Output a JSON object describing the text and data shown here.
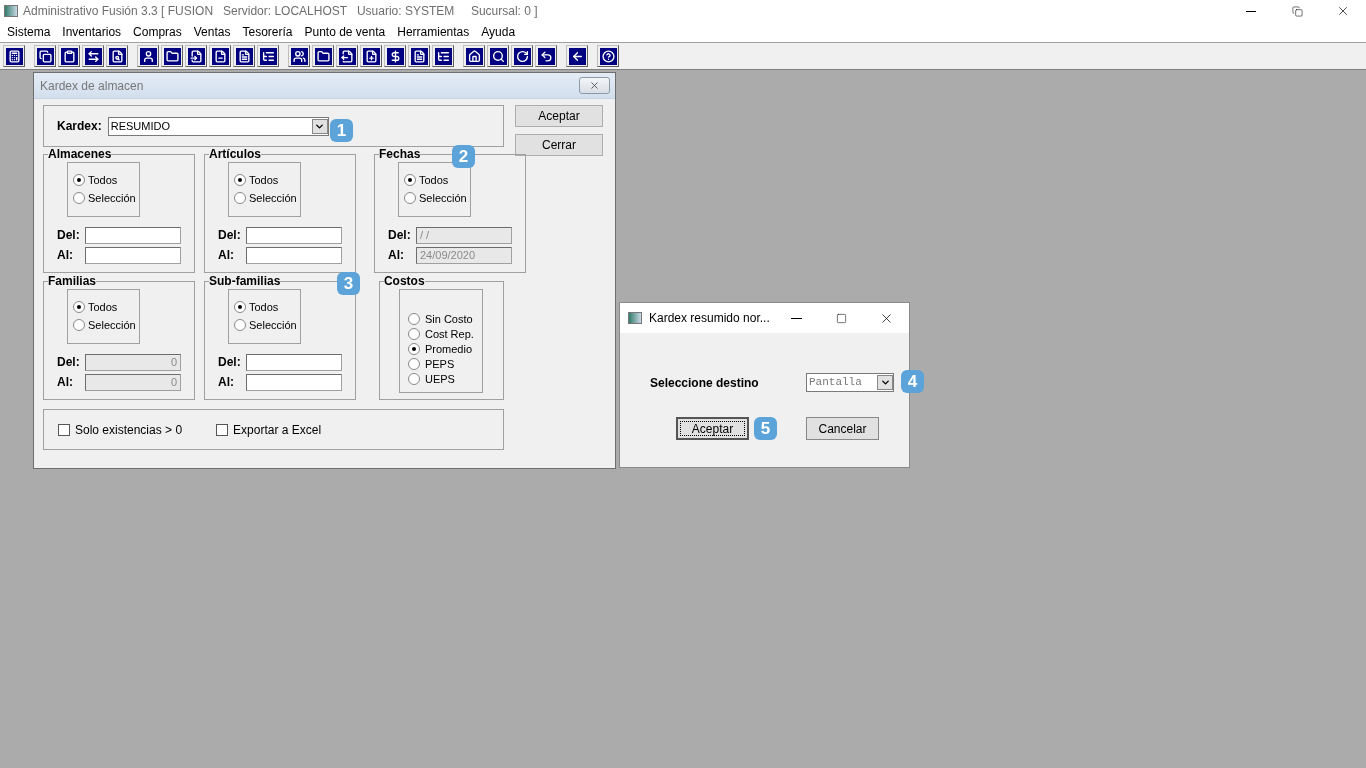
{
  "app_window": {
    "title": "Administrativo Fusión 3.3 [ FUSION   Servidor: LOCALHOST   Usuario: SYSTEM     Sucursal: 0 ]",
    "menu": [
      "Sistema",
      "Inventarios",
      "Compras",
      "Ventas",
      "Tesorería",
      "Punto de venta",
      "Herramientas",
      "Ayuda"
    ]
  },
  "kardex_dialog": {
    "title": "Kardex de almacen",
    "kardex_label": "Kardex:",
    "kardex_value": "RESUMIDO",
    "buttons": [
      {
        "label": "Aceptar"
      },
      {
        "label": "Cerrar"
      }
    ],
    "groups": [
      {
        "title": "Almacenes",
        "options": [
          {
            "label": "Todos",
            "selected": true
          },
          {
            "label": "Selección",
            "selected": false
          }
        ],
        "fields": [
          {
            "label": "Del:"
          },
          {
            "label": "Al:"
          }
        ]
      },
      {
        "title": "Artículos",
        "options": [
          {
            "label": "Todos",
            "selected": true
          },
          {
            "label": "Selección",
            "selected": false
          }
        ],
        "fields": [
          {
            "label": "Del:"
          },
          {
            "label": "Al:"
          }
        ]
      },
      {
        "title": "Fechas",
        "options": [
          {
            "label": "Todos",
            "selected": true
          },
          {
            "label": "Selección",
            "selected": false
          }
        ],
        "fields": [
          {
            "label": "Del:",
            "value": "/ /",
            "disabled": true
          },
          {
            "label": "Al:",
            "value": "24/09/2020",
            "disabled": true
          }
        ]
      },
      {
        "title": "Familias",
        "options": [
          {
            "label": "Todos",
            "selected": true
          },
          {
            "label": "Selección",
            "selected": false
          }
        ],
        "fields": [
          {
            "label": "Del:",
            "value": "0",
            "disabled": true
          },
          {
            "label": "Al:",
            "value": "0",
            "disabled": true
          }
        ]
      },
      {
        "title": "Sub-familias",
        "options": [
          {
            "label": "Todos",
            "selected": true
          },
          {
            "label": "Selección",
            "selected": false
          }
        ],
        "fields": [
          {
            "label": "Del:"
          },
          {
            "label": "Al:"
          }
        ]
      },
      {
        "title": "Costos",
        "options": [
          {
            "label": "Sin Costo",
            "selected": false
          },
          {
            "label": "Cost Rep.",
            "selected": false
          },
          {
            "label": "Promedio",
            "selected": true
          },
          {
            "label": "PEPS",
            "selected": false
          },
          {
            "label": "UEPS",
            "selected": false
          }
        ]
      }
    ],
    "checkboxes": [
      {
        "label": "Solo existencias > 0",
        "checked": false
      },
      {
        "label": "Exportar a Excel",
        "checked": false
      }
    ]
  },
  "destino_dialog": {
    "title": "Kardex resumido nor...",
    "label": "Seleccione destino",
    "value": "Pantalla",
    "buttons": [
      {
        "label": "Aceptar",
        "focused": true
      },
      {
        "label": "Cancelar",
        "focused": false
      }
    ]
  },
  "callouts": [
    "1",
    "2",
    "3",
    "4",
    "5"
  ]
}
